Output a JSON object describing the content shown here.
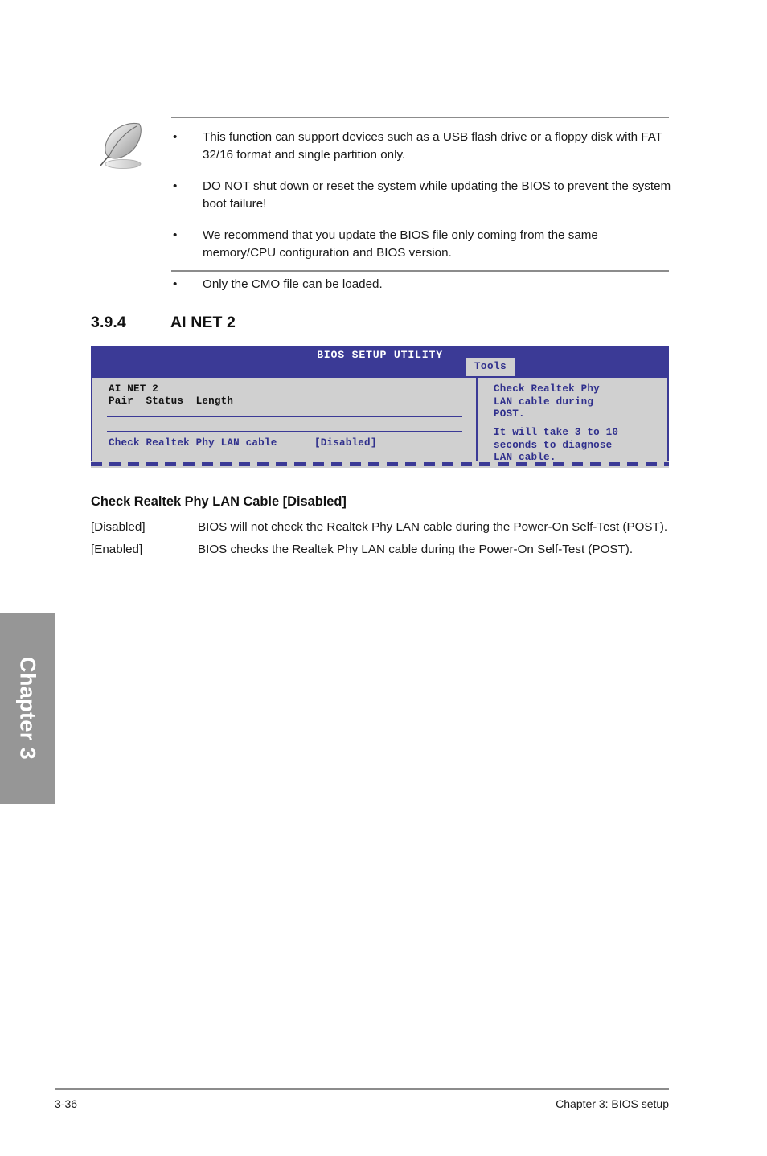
{
  "note": {
    "icon_name": "quill-pen-note-icon",
    "bullet_glyph": "•",
    "items": [
      "This function can support devices such as a USB flash drive or a floppy disk with FAT 32/16 format and single partition only.",
      "DO NOT shut down or reset the system while updating the BIOS to prevent the system boot failure!",
      "We recommend that you update the BIOS file only coming from the same memory/CPU configuration and BIOS version.",
      "Only the CMO file can be loaded."
    ]
  },
  "section": {
    "number": "3.9.4",
    "title": "AI NET 2"
  },
  "bios": {
    "title": "BIOS SETUP UTILITY",
    "tab": "Tools",
    "main": {
      "heading": "AI NET 2",
      "columns": "Pair  Status  Length",
      "option_label": "Check Realtek Phy LAN cable",
      "option_value": "[Disabled]"
    },
    "help": {
      "paragraph1": "Check Realtek Phy\nLAN cable during\nPOST.",
      "paragraph2": "It will take 3 to 10\nseconds to diagnose\nLAN cable."
    },
    "colors": {
      "header_blue": "#3b3a96",
      "panel_gray": "#d0d0d0",
      "text_blue": "#2f2f8c"
    }
  },
  "option_doc": {
    "heading": "Check Realtek Phy LAN Cable [Disabled]",
    "rows": [
      {
        "key": "[Disabled]",
        "description": "BIOS will not check the Realtek Phy LAN cable during the Power-On Self-Test (POST)."
      },
      {
        "key": "[Enabled]",
        "description": "BIOS checks the Realtek Phy LAN cable during the Power-On Self-Test (POST)."
      }
    ]
  },
  "chapter_tab": {
    "label": "Chapter 3",
    "color": "#969696"
  },
  "footer": {
    "page_number": "3-36",
    "chapter_title": "Chapter 3: BIOS setup"
  }
}
